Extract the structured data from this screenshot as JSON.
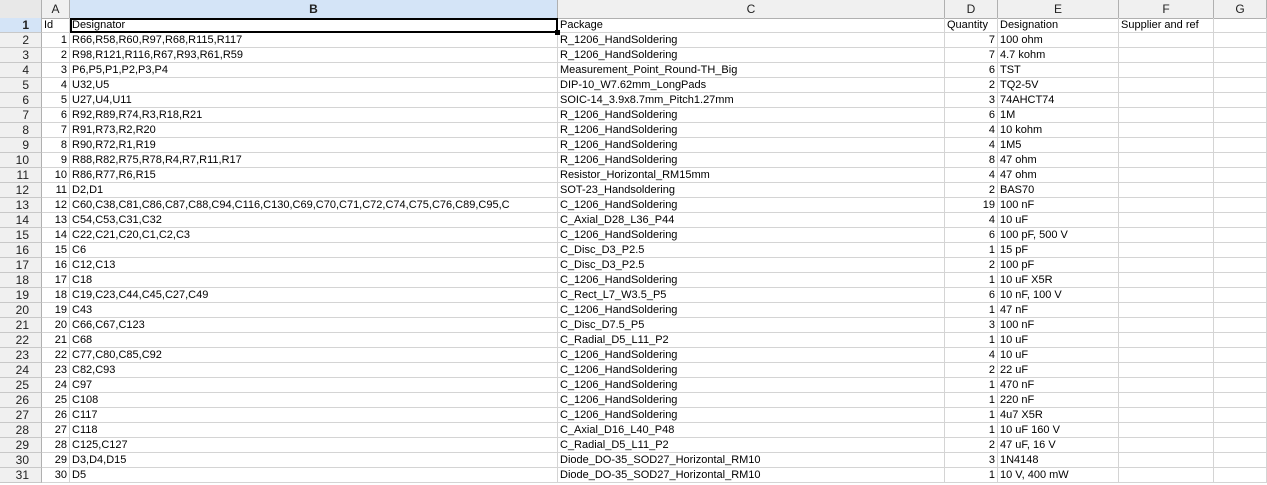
{
  "columns": [
    "A",
    "B",
    "C",
    "D",
    "E",
    "F",
    "G"
  ],
  "selected_column": "B",
  "header_row": {
    "row": "1",
    "a": "Id",
    "b": "Designator",
    "c": "Package",
    "d": "Quantity",
    "e": "Designation",
    "f": "Supplier and ref"
  },
  "rows": [
    {
      "row": "2",
      "a": "1",
      "b": "R66,R58,R60,R97,R68,R115,R117",
      "c": "R_1206_HandSoldering",
      "d": "7",
      "e": "100 ohm"
    },
    {
      "row": "3",
      "a": "2",
      "b": "R98,R121,R116,R67,R93,R61,R59",
      "c": "R_1206_HandSoldering",
      "d": "7",
      "e": "4.7 kohm"
    },
    {
      "row": "4",
      "a": "3",
      "b": "P6,P5,P1,P2,P3,P4",
      "c": "Measurement_Point_Round-TH_Big",
      "d": "6",
      "e": "TST"
    },
    {
      "row": "5",
      "a": "4",
      "b": "U32,U5",
      "c": "DIP-10_W7.62mm_LongPads",
      "d": "2",
      "e": "TQ2-5V"
    },
    {
      "row": "6",
      "a": "5",
      "b": "U27,U4,U11",
      "c": "SOIC-14_3.9x8.7mm_Pitch1.27mm",
      "d": "3",
      "e": "74AHCT74"
    },
    {
      "row": "7",
      "a": "6",
      "b": "R92,R89,R74,R3,R18,R21",
      "c": "R_1206_HandSoldering",
      "d": "6",
      "e": "1M"
    },
    {
      "row": "8",
      "a": "7",
      "b": "R91,R73,R2,R20",
      "c": "R_1206_HandSoldering",
      "d": "4",
      "e": "10 kohm"
    },
    {
      "row": "9",
      "a": "8",
      "b": "R90,R72,R1,R19",
      "c": "R_1206_HandSoldering",
      "d": "4",
      "e": "1M5"
    },
    {
      "row": "10",
      "a": "9",
      "b": "R88,R82,R75,R78,R4,R7,R11,R17",
      "c": "R_1206_HandSoldering",
      "d": "8",
      "e": "47 ohm"
    },
    {
      "row": "11",
      "a": "10",
      "b": "R86,R77,R6,R15",
      "c": "Resistor_Horizontal_RM15mm",
      "d": "4",
      "e": "47 ohm"
    },
    {
      "row": "12",
      "a": "11",
      "b": "D2,D1",
      "c": "SOT-23_Handsoldering",
      "d": "2",
      "e": "BAS70"
    },
    {
      "row": "13",
      "a": "12",
      "b": "C60,C38,C81,C86,C87,C88,C94,C116,C130,C69,C70,C71,C72,C74,C75,C76,C89,C95,C",
      "c": "C_1206_HandSoldering",
      "d": "19",
      "e": "100 nF"
    },
    {
      "row": "14",
      "a": "13",
      "b": "C54,C53,C31,C32",
      "c": "C_Axial_D28_L36_P44",
      "d": "4",
      "e": "10 uF"
    },
    {
      "row": "15",
      "a": "14",
      "b": "C22,C21,C20,C1,C2,C3",
      "c": "C_1206_HandSoldering",
      "d": "6",
      "e": "100 pF, 500 V"
    },
    {
      "row": "16",
      "a": "15",
      "b": "C6",
      "c": "C_Disc_D3_P2.5",
      "d": "1",
      "e": "15 pF"
    },
    {
      "row": "17",
      "a": "16",
      "b": "C12,C13",
      "c": "C_Disc_D3_P2.5",
      "d": "2",
      "e": "100 pF"
    },
    {
      "row": "18",
      "a": "17",
      "b": "C18",
      "c": "C_1206_HandSoldering",
      "d": "1",
      "e": "10 uF X5R"
    },
    {
      "row": "19",
      "a": "18",
      "b": "C19,C23,C44,C45,C27,C49",
      "c": "C_Rect_L7_W3.5_P5",
      "d": "6",
      "e": "10 nF, 100 V"
    },
    {
      "row": "20",
      "a": "19",
      "b": "C43",
      "c": "C_1206_HandSoldering",
      "d": "1",
      "e": "47 nF"
    },
    {
      "row": "21",
      "a": "20",
      "b": "C66,C67,C123",
      "c": "C_Disc_D7.5_P5",
      "d": "3",
      "e": "100 nF"
    },
    {
      "row": "22",
      "a": "21",
      "b": "C68",
      "c": "C_Radial_D5_L11_P2",
      "d": "1",
      "e": "10 uF"
    },
    {
      "row": "23",
      "a": "22",
      "b": "C77,C80,C85,C92",
      "c": "C_1206_HandSoldering",
      "d": "4",
      "e": "10 uF"
    },
    {
      "row": "24",
      "a": "23",
      "b": "C82,C93",
      "c": "C_1206_HandSoldering",
      "d": "2",
      "e": "22 uF"
    },
    {
      "row": "25",
      "a": "24",
      "b": "C97",
      "c": "C_1206_HandSoldering",
      "d": "1",
      "e": "470 nF"
    },
    {
      "row": "26",
      "a": "25",
      "b": "C108",
      "c": "C_1206_HandSoldering",
      "d": "1",
      "e": "220 nF"
    },
    {
      "row": "27",
      "a": "26",
      "b": "C117",
      "c": "C_1206_HandSoldering",
      "d": "1",
      "e": "4u7 X5R"
    },
    {
      "row": "28",
      "a": "27",
      "b": "C118",
      "c": "C_Axial_D16_L40_P48",
      "d": "1",
      "e": "10 uF 160 V"
    },
    {
      "row": "29",
      "a": "28",
      "b": "C125,C127",
      "c": "C_Radial_D5_L11_P2",
      "d": "2",
      "e": "47 uF, 16 V"
    },
    {
      "row": "30",
      "a": "29",
      "b": "D3,D4,D15",
      "c": "Diode_DO-35_SOD27_Horizontal_RM10",
      "d": "3",
      "e": "1N4148"
    },
    {
      "row": "31",
      "a": "30",
      "b": "D5",
      "c": "Diode_DO-35_SOD27_Horizontal_RM10",
      "d": "1",
      "e": "10 V, 400 mW"
    }
  ]
}
